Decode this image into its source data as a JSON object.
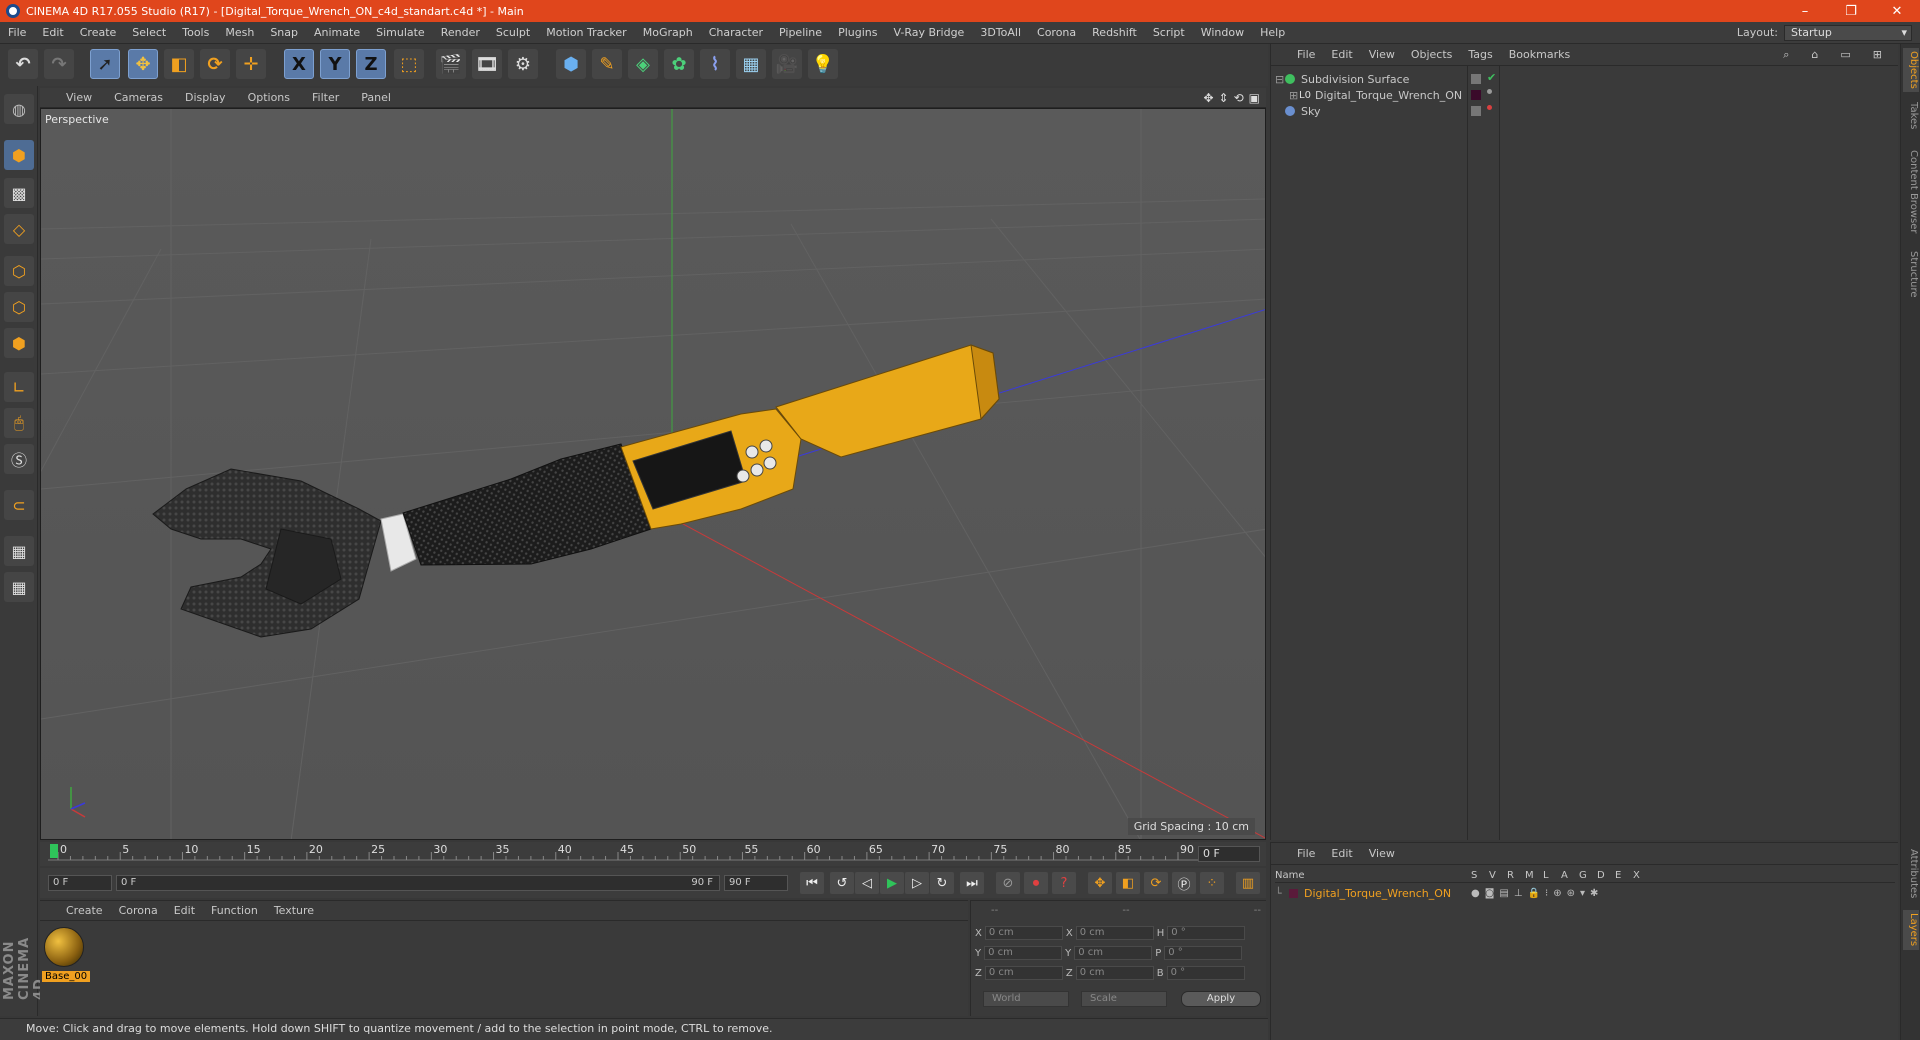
{
  "window": {
    "title": "CINEMA 4D R17.055 Studio (R17) - [Digital_Torque_Wrench_ON_c4d_standart.c4d *] - Main",
    "minimize": "–",
    "maximize": "❐",
    "close": "✕"
  },
  "menubar": {
    "items": [
      "File",
      "Edit",
      "Create",
      "Select",
      "Tools",
      "Mesh",
      "Snap",
      "Animate",
      "Simulate",
      "Render",
      "Sculpt",
      "Motion Tracker",
      "MoGraph",
      "Character",
      "Pipeline",
      "Plugins",
      "V-Ray Bridge",
      "3DToAll",
      "Corona",
      "Redshift",
      "Script",
      "Window",
      "Help"
    ],
    "layout_label": "Layout:",
    "layout_value": "Startup"
  },
  "toolbar": {
    "axis_x": "X",
    "axis_y": "Y",
    "axis_z": "Z"
  },
  "viewport": {
    "menu": [
      "View",
      "Cameras",
      "Display",
      "Options",
      "Filter",
      "Panel"
    ],
    "label": "Perspective",
    "grid_spacing": "Grid Spacing : 10 cm"
  },
  "timeline": {
    "ticks": [
      "0",
      "5",
      "10",
      "15",
      "20",
      "25",
      "30",
      "35",
      "40",
      "45",
      "50",
      "55",
      "60",
      "65",
      "70",
      "75",
      "80",
      "85",
      "90"
    ],
    "current_frame": "0 F",
    "start_field": "0 F",
    "range_start": "0 F",
    "range_end": "90 F",
    "end_field": "90 F"
  },
  "materials": {
    "menu": [
      "Create",
      "Corona",
      "Edit",
      "Function",
      "Texture"
    ],
    "items": [
      {
        "name": "Base_00"
      }
    ]
  },
  "coordinates": {
    "headers": [
      "--",
      "--",
      "--"
    ],
    "rows": [
      {
        "a": "X",
        "av": "0 cm",
        "b": "X",
        "bv": "0 cm",
        "c": "H",
        "cv": "0 °"
      },
      {
        "a": "Y",
        "av": "0 cm",
        "b": "Y",
        "bv": "0 cm",
        "c": "P",
        "cv": "0 °"
      },
      {
        "a": "Z",
        "av": "0 cm",
        "b": "Z",
        "bv": "0 cm",
        "c": "B",
        "cv": "0 °"
      }
    ],
    "mode": "World",
    "transform": "Scale",
    "apply": "Apply"
  },
  "object_manager": {
    "menu": [
      "File",
      "Edit",
      "View",
      "Objects",
      "Tags",
      "Bookmarks"
    ],
    "objects": [
      {
        "name": "Subdivision Surface",
        "color": "#3fbf5f"
      },
      {
        "name": "Digital_Torque_Wrench_ON",
        "color": "#9a9a9a"
      },
      {
        "name": "Sky",
        "color": "#6a8fcf"
      }
    ]
  },
  "layer_manager": {
    "menu": [
      "File",
      "Edit",
      "View"
    ],
    "col_name": "Name",
    "flags": [
      "S",
      "V",
      "R",
      "M",
      "L",
      "A",
      "G",
      "D",
      "E",
      "X"
    ],
    "layer": {
      "name": "Digital_Torque_Wrench_ON",
      "color": "#5a1a3a"
    }
  },
  "side_tabs": [
    "Objects",
    "Takes",
    "Content Browser",
    "Structure"
  ],
  "side_tabs_lower": [
    "Attributes",
    "Layers"
  ],
  "statusbar": {
    "text": "Move: Click and drag to move elements. Hold down SHIFT to quantize movement / add to the selection in point mode, CTRL to remove."
  },
  "branding": {
    "logo": "MAXON CINEMA 4D"
  },
  "colors": {
    "titlebar": "#e0461c",
    "accent_orange": "#f0a020",
    "wrench_yellow": "#e8a818"
  }
}
